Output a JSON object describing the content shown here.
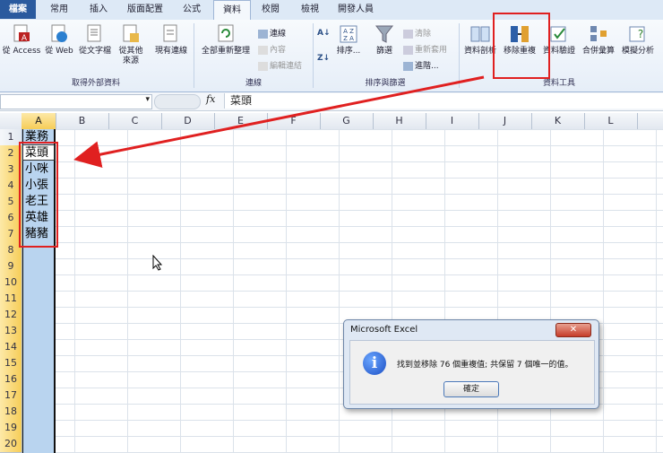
{
  "tabs": [
    "檔案",
    "常用",
    "插入",
    "版面配置",
    "公式",
    "資料",
    "校閱",
    "檢視",
    "開發人員"
  ],
  "ribbon": {
    "groups": {
      "external": "取得外部資料",
      "connections": "連線",
      "sortfilter": "排序與篩選",
      "tools": "資料工具"
    },
    "buttons": {
      "access": "從 Access",
      "web": "從 Web",
      "text": "從文字檔",
      "other": "從其他",
      "other2": "來源",
      "existing": "現有連線",
      "refresh": "全部重新整理",
      "conn": "連線",
      "props": "內容",
      "editlinks": "編輯連結",
      "sort": "排序...",
      "filter": "篩選",
      "clear": "清除",
      "reapply": "重新套用",
      "advanced": "進階...",
      "text_to_cols": "資料剖析",
      "remove_dup": "移除重複",
      "validation": "資料驗證",
      "consolidate": "合併彙算",
      "whatif": "模擬分析"
    }
  },
  "formula": {
    "value": "菜頭",
    "fx": "fx"
  },
  "columns": [
    "A",
    "B",
    "C",
    "D",
    "E",
    "F",
    "G",
    "H",
    "I",
    "J",
    "K",
    "L"
  ],
  "rows": [
    "1",
    "2",
    "3",
    "4",
    "5",
    "6",
    "7",
    "8",
    "9",
    "10",
    "11",
    "12",
    "13",
    "14",
    "15",
    "16",
    "17",
    "18",
    "19",
    "20"
  ],
  "cells": [
    "業務",
    "菜頭",
    "小咪",
    "小張",
    "老王",
    "英雄",
    "豬豬"
  ],
  "dialog": {
    "title": "Microsoft Excel",
    "close": "✕",
    "icon": "i",
    "message": "找到並移除 76 個重複值; 共保留 7 個唯一的值。",
    "ok": "確定"
  }
}
